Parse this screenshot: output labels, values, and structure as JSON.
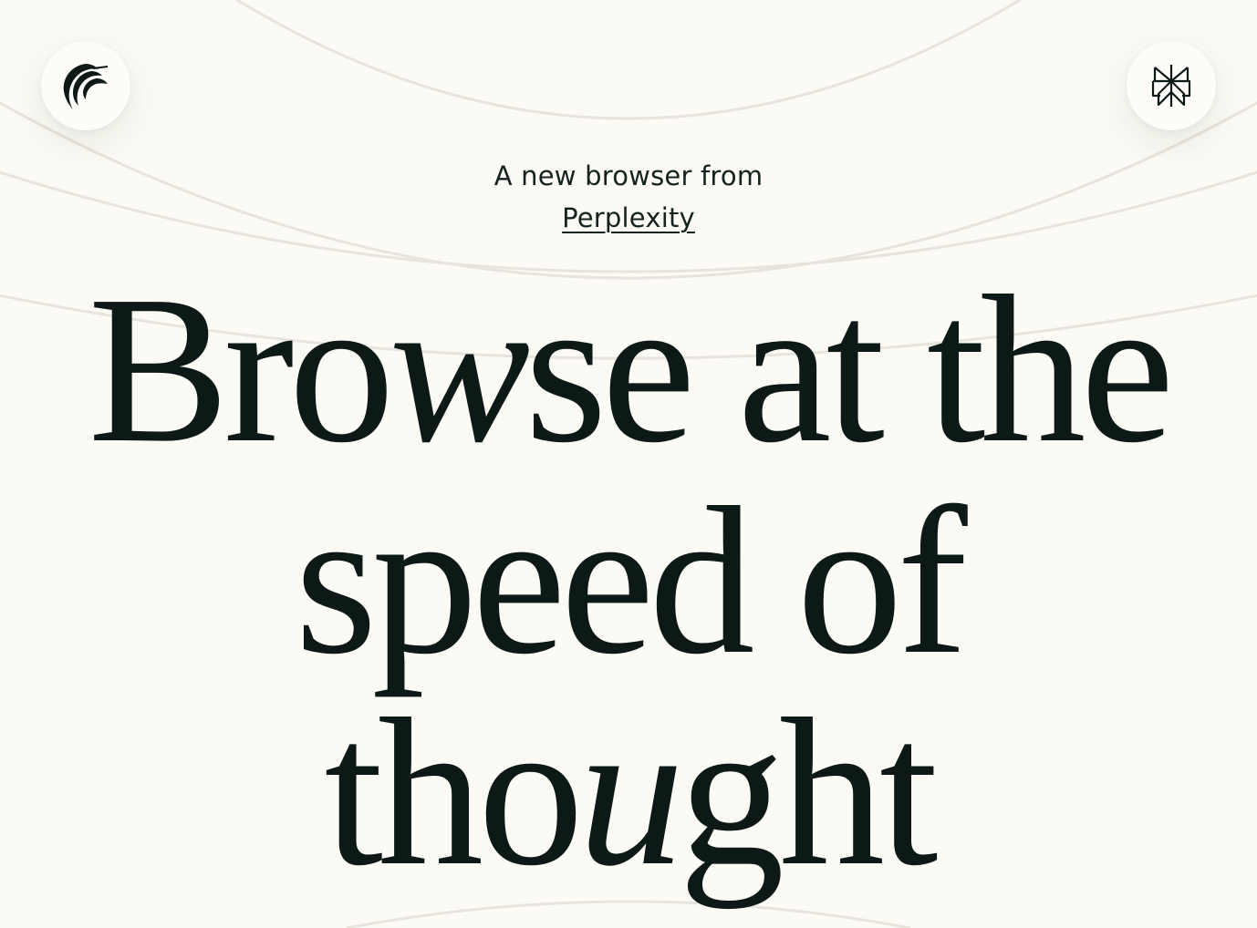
{
  "header": {
    "left_logo_icon": "comet-logo-icon",
    "right_logo_icon": "perplexity-logo-icon"
  },
  "tagline": {
    "line1": "A new browser from",
    "link_text": "Perplexity"
  },
  "headline": {
    "line1": {
      "before": "Bro",
      "italic": "w",
      "after": "se at the"
    },
    "line2": {
      "text": "speed of"
    },
    "line3": {
      "before": "tho",
      "italic": "u",
      "after": "ght"
    }
  },
  "colors": {
    "background": "#fbfaf4",
    "text": "#0c1916",
    "arc_stroke": "#e6e4dc"
  }
}
